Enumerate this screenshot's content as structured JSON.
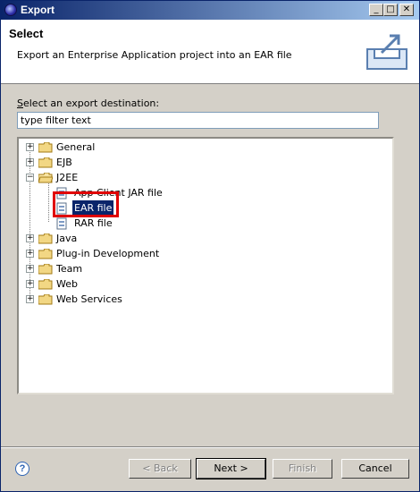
{
  "window": {
    "title": "Export"
  },
  "header": {
    "title": "Select",
    "description": "Export an Enterprise Application project into an EAR file"
  },
  "destination_label": {
    "accel": "S",
    "rest": "elect an export destination:"
  },
  "filter": {
    "value": "type filter text"
  },
  "tree": {
    "general": "General",
    "ejb": "EJB",
    "j2ee": "J2EE",
    "app_client": "App Client JAR file",
    "ear": "EAR file",
    "rar": "RAR file",
    "java": "Java",
    "plugin": "Plug-in Development",
    "team": "Team",
    "web": "Web",
    "web_services": "Web Services"
  },
  "buttons": {
    "back": "< Back",
    "next": "Next >",
    "finish": "Finish",
    "cancel": "Cancel"
  },
  "colors": {
    "selection": "#0a246a",
    "highlight_box": "#e00000",
    "title_bar": "#0a246a"
  },
  "icons": [
    "app-icon",
    "minimize-icon",
    "maximize-icon",
    "close-icon",
    "export-banner-icon",
    "folder-icon",
    "file-icon",
    "help-icon"
  ]
}
